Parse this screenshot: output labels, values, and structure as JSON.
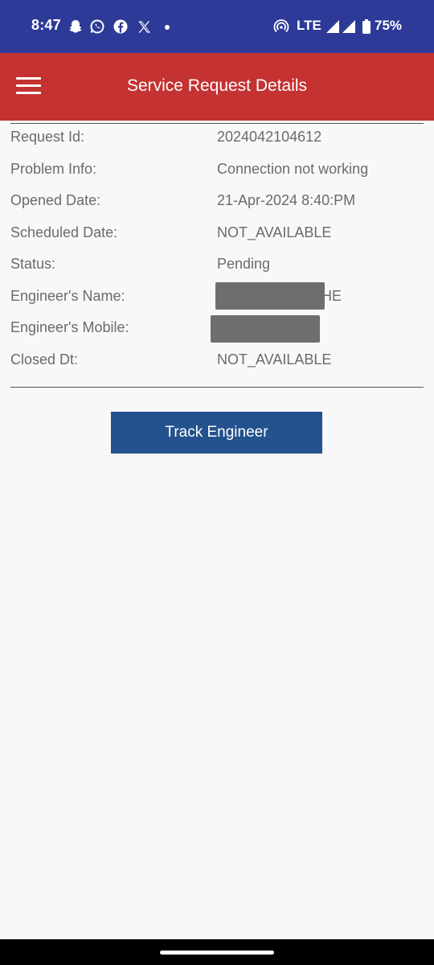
{
  "status_bar": {
    "time": "8:47",
    "network": "LTE",
    "battery": "75%",
    "notification_icons": [
      "snapchat-icon",
      "whatsapp-icon",
      "facebook-icon",
      "x-icon"
    ],
    "bg_color": "#2e3a97"
  },
  "app_bar": {
    "title": "Service Request Details",
    "bg_color": "#c43232"
  },
  "details": [
    {
      "label": "Request Id:",
      "value": "2024042104612"
    },
    {
      "label": "Problem Info:",
      "value": "Connection not working"
    },
    {
      "label": "Opened Date:",
      "value": "21-Apr-2024 8:40:PM"
    },
    {
      "label": "Scheduled Date:",
      "value": "NOT_AVAILABLE"
    },
    {
      "label": "Status:",
      "value": "Pending"
    },
    {
      "label": "Engineer's Name:",
      "value": "HE",
      "redacted": true
    },
    {
      "label": "Engineer's Mobile:",
      "value": "",
      "redacted": true
    },
    {
      "label": "Closed Dt:",
      "value": "NOT_AVAILABLE"
    }
  ],
  "actions": {
    "track_engineer_label": "Track Engineer",
    "button_color": "#24528e"
  }
}
